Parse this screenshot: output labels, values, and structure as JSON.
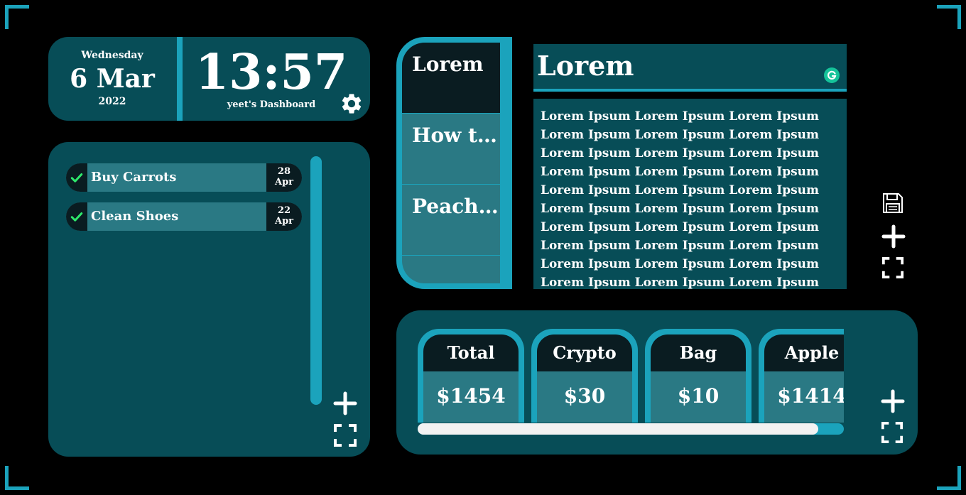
{
  "clock": {
    "weekday": "Wednesday",
    "day_month": "6 Mar",
    "year": "2022",
    "time": "13:57",
    "dashboard_label": "yeet's Dashboard"
  },
  "todo": {
    "items": [
      {
        "label": "Buy Carrots",
        "day": "28",
        "month": "Apr"
      },
      {
        "label": "Clean Shoes",
        "day": "22",
        "month": "Apr"
      }
    ]
  },
  "notes": {
    "tabs": [
      "Lorem",
      "How to ...",
      "Peach ...",
      ""
    ],
    "title": "Lorem",
    "body_lines": [
      "Lorem Ipsum Lorem Ipsum Lorem Ipsum",
      "Lorem Ipsum Lorem Ipsum Lorem Ipsum",
      "Lorem Ipsum Lorem Ipsum Lorem Ipsum",
      "Lorem Ipsum Lorem Ipsum Lorem Ipsum",
      "Lorem Ipsum Lorem Ipsum Lorem Ipsum",
      "Lorem Ipsum Lorem Ipsum Lorem Ipsum",
      "Lorem Ipsum Lorem Ipsum Lorem Ipsum",
      "Lorem Ipsum Lorem Ipsum Lorem Ipsum",
      "Lorem Ipsum Lorem Ipsum Lorem Ipsum",
      "Lorem Ipsum Lorem Ipsum Lorem Ipsum"
    ]
  },
  "finance": {
    "tiles": [
      {
        "name": "Total",
        "value": "$1454"
      },
      {
        "name": "Crypto",
        "value": "$30"
      },
      {
        "name": "Bag",
        "value": "$10"
      },
      {
        "name": "Apple",
        "value": "$1414"
      }
    ],
    "scroll_fraction": 0.94
  },
  "icons": {
    "settings": "gear-icon",
    "save": "save-icon",
    "add": "plus-icon",
    "fullscreen": "fullscreen-icon",
    "check": "check-icon",
    "grammar": "grammarly-icon"
  },
  "colors": {
    "background": "#000000",
    "panel": "#074d57",
    "accent": "#1ba3bc",
    "tile": "#2a7984",
    "dark": "#0a1c21",
    "check": "#2ee86b"
  }
}
